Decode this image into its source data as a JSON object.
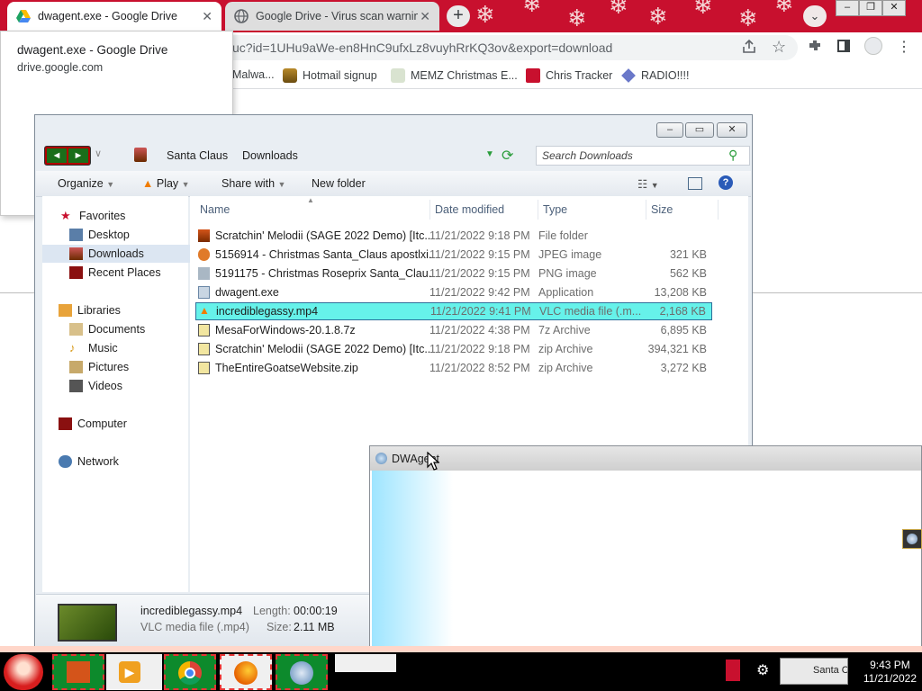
{
  "chrome": {
    "tabs": [
      {
        "title": "dwagent.exe - Google Drive",
        "active": true
      },
      {
        "title": "Google Drive - Virus scan warnin",
        "active": false
      }
    ],
    "new_tab": "+",
    "close_glyph": "✕",
    "url": "uc?id=1UHu9aWe-en8HnC9ufxLz8vuyhRrKQ3ov&export=download",
    "bookmarks": [
      "Malwa...",
      "Hotmail signup",
      "MEMZ Christmas E...",
      "Chris Tracker",
      "RADIO!!!!"
    ],
    "hover_card": {
      "title": "dwagent.exe - Google Drive",
      "domain": "drive.google.com"
    },
    "colors": {
      "tabstrip": "#c8102e",
      "omnibox": "#f1f3f4"
    }
  },
  "explorer": {
    "breadcrumb": [
      "Santa Claus",
      "Downloads"
    ],
    "search_placeholder": "Search Downloads",
    "commands": [
      "Organize",
      "Play",
      "Share with",
      "New folder"
    ],
    "nav": {
      "favorites": "Favorites",
      "favorite_items": [
        "Desktop",
        "Downloads",
        "Recent Places"
      ],
      "libraries": "Libraries",
      "library_items": [
        "Documents",
        "Music",
        "Pictures",
        "Videos"
      ],
      "computer": "Computer",
      "network": "Network"
    },
    "columns": [
      "Name",
      "Date modified",
      "Type",
      "Size"
    ],
    "files": [
      {
        "name": "Scratchin' Melodii (SAGE 2022 Demo) [Itc...",
        "date": "11/21/2022 9:18 PM",
        "type": "File folder",
        "size": ""
      },
      {
        "name": "5156914 - Christmas Santa_Claus apostlxi...",
        "date": "11/21/2022 9:15 PM",
        "type": "JPEG image",
        "size": "321 KB"
      },
      {
        "name": "5191175 - Christmas Roseprix Santa_Clau...",
        "date": "11/21/2022 9:15 PM",
        "type": "PNG image",
        "size": "562 KB"
      },
      {
        "name": "dwagent.exe",
        "date": "11/21/2022 9:42 PM",
        "type": "Application",
        "size": "13,208 KB"
      },
      {
        "name": "incrediblegassy.mp4",
        "date": "11/21/2022 9:41 PM",
        "type": "VLC media file (.m...",
        "size": "2,168 KB"
      },
      {
        "name": "MesaForWindows-20.1.8.7z",
        "date": "11/21/2022 4:38 PM",
        "type": "7z Archive",
        "size": "6,895 KB"
      },
      {
        "name": "Scratchin' Melodii (SAGE 2022 Demo) [Itc...",
        "date": "11/21/2022 9:18 PM",
        "type": "zip Archive",
        "size": "394,321 KB"
      },
      {
        "name": "TheEntireGoatseWebsite.zip",
        "date": "11/21/2022 8:52 PM",
        "type": "zip Archive",
        "size": "3,272 KB"
      }
    ],
    "selected_index": 4,
    "details": {
      "filename": "incrediblegassy.mp4",
      "filetype": "VLC media file (.mp4)",
      "length_label": "Length:",
      "length": "00:00:19",
      "size_label": "Size:",
      "size": "2.11 MB"
    },
    "colors": {
      "selection": "#66f2ea"
    }
  },
  "dwagent": {
    "title": "DWAgent"
  },
  "taskbar": {
    "clock_time": "9:43 PM",
    "clock_date": "11/21/2022",
    "tray_text": "Santa C"
  }
}
